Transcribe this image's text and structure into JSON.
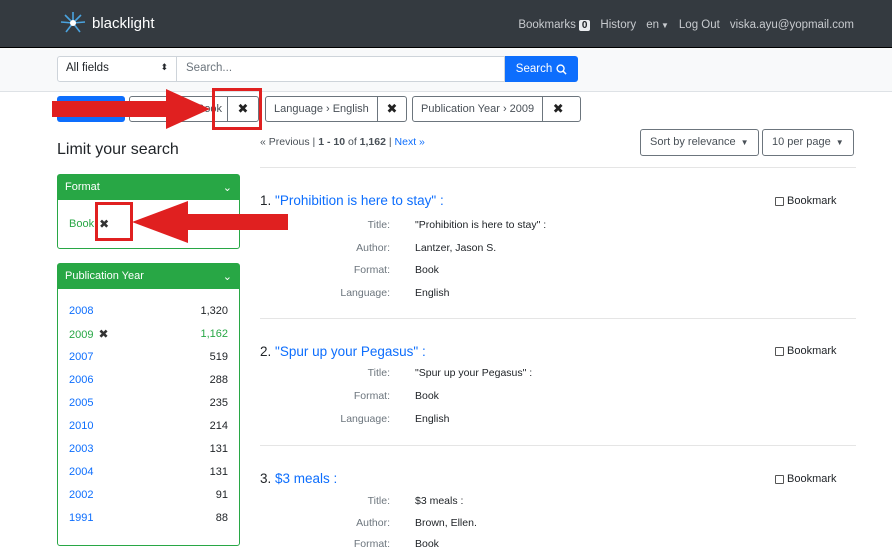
{
  "navbar": {
    "brand": "blacklight",
    "bookmarks_label": "Bookmarks",
    "bookmarks_count": "0",
    "history_label": "History",
    "language_label": "en",
    "logout_label": "Log Out",
    "user_email": "viska.ayu@yopmail.com"
  },
  "search": {
    "field_selected": "All fields",
    "placeholder": "Search...",
    "button_label": "Search"
  },
  "constraints": {
    "first_value_partial": "Book",
    "remove_symbol": "✖",
    "language": "Language › English",
    "year": "Publication Year › 2009"
  },
  "sidebar": {
    "title": "Limit your search",
    "format": {
      "heading": "Format",
      "selected": "Book"
    },
    "pub_year": {
      "heading": "Publication Year",
      "items": [
        {
          "label": "2008",
          "count": "1,320"
        },
        {
          "label": "2009",
          "count": "1,162"
        },
        {
          "label": "2007",
          "count": "519"
        },
        {
          "label": "2006",
          "count": "288"
        },
        {
          "label": "2005",
          "count": "235"
        },
        {
          "label": "2010",
          "count": "214"
        },
        {
          "label": "2003",
          "count": "131"
        },
        {
          "label": "2004",
          "count": "131"
        },
        {
          "label": "2002",
          "count": "91"
        },
        {
          "label": "1991",
          "count": "88"
        }
      ]
    }
  },
  "results": {
    "pager": {
      "previous": "« Previous",
      "separator": "|",
      "range_start": "1",
      "range_sep": "-",
      "range_end": "10",
      "of": "of",
      "total": "1,162",
      "next": "Next »"
    },
    "sort_label": "Sort by relevance",
    "per_page_label": "10 per page",
    "bookmark_label": "Bookmark",
    "docs": [
      {
        "number": "1.",
        "title": "\"Prohibition is here to stay\" :",
        "fields": [
          {
            "key": "Title:",
            "value": "\"Prohibition is here to stay\" :"
          },
          {
            "key": "Author:",
            "value": "Lantzer, Jason S."
          },
          {
            "key": "Format:",
            "value": "Book"
          },
          {
            "key": "Language:",
            "value": "English"
          }
        ]
      },
      {
        "number": "2.",
        "title": "\"Spur up your Pegasus\" :",
        "fields": [
          {
            "key": "Title:",
            "value": "\"Spur up your Pegasus\" :"
          },
          {
            "key": "Format:",
            "value": "Book"
          },
          {
            "key": "Language:",
            "value": "English"
          }
        ]
      },
      {
        "number": "3.",
        "title": "$3 meals :",
        "fields": [
          {
            "key": "Title:",
            "value": "$3 meals :"
          },
          {
            "key": "Author:",
            "value": "Brown, Ellen."
          },
          {
            "key": "Format:",
            "value": "Book"
          }
        ]
      }
    ]
  },
  "colors": {
    "navbar": "#343a40",
    "primary": "#0d6efd",
    "facet_green": "#28a745",
    "annotation_red": "#e02020"
  }
}
